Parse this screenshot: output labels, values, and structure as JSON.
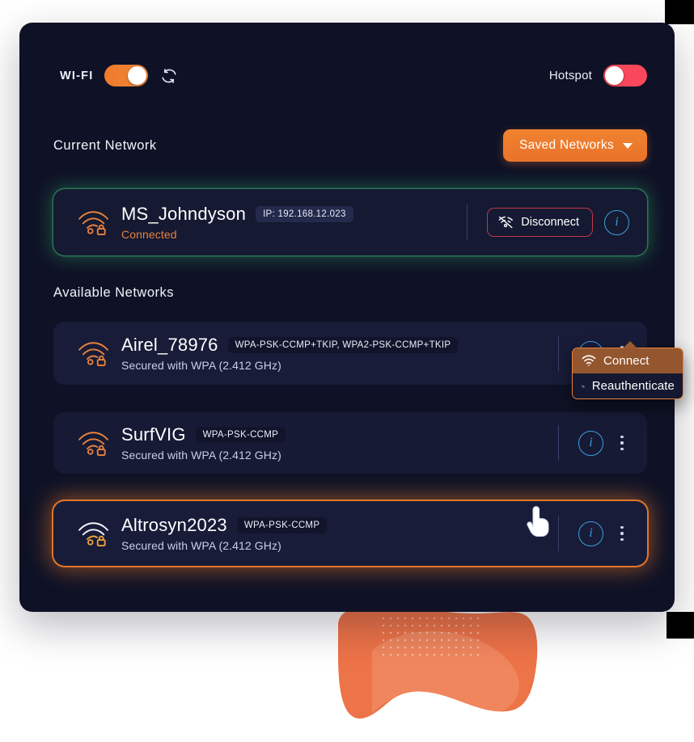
{
  "header": {
    "wifi_label": "WI-FI",
    "wifi_toggle_state": "on",
    "refresh_icon": "refresh-icon",
    "hotspot_label": "Hotspot",
    "hotspot_toggle_state": "off"
  },
  "sections": {
    "current_title": "Current Network",
    "available_title": "Available Networks",
    "saved_networks_label": "Saved Networks"
  },
  "current_network": {
    "ssid": "MS_Johndyson",
    "ip_badge": "IP: 192.168.12.023",
    "status": "Connected",
    "disconnect_label": "Disconnect",
    "info_label": "i",
    "icon": "wifi-locked-icon"
  },
  "available_networks": [
    {
      "ssid": "Airel_78976",
      "security_badge": "WPA-PSK-CCMP+TKIP, WPA2-PSK-CCMP+TKIP",
      "detail": "Secured with WPA (2.412 GHz)",
      "info_label": "i",
      "icon": "wifi-locked-icon"
    },
    {
      "ssid": "SurfVIG",
      "security_badge": "WPA-PSK-CCMP",
      "detail": "Secured with WPA (2.412 GHz)",
      "info_label": "i",
      "icon": "wifi-locked-icon"
    },
    {
      "ssid": "Altrosyn2023",
      "security_badge": "WPA-PSK-CCMP",
      "detail": "Secured with WPA (2.412 GHz)",
      "info_label": "i",
      "icon": "wifi-locked-icon"
    }
  ],
  "context_menu": {
    "items": [
      {
        "label": "Connect",
        "icon": "wifi-icon",
        "highlighted": true
      },
      {
        "label": "Reauthenticate",
        "icon": "user-lock-icon",
        "highlighted": false
      }
    ]
  },
  "colors": {
    "accent_orange": "#e8823c",
    "panel_bg": "#0f1226",
    "card_bg": "#161a35",
    "toggle_on": "#f07b2a",
    "toggle_off": "#f9485b",
    "info_blue": "#3a9fdd",
    "danger_red": "#c2384a",
    "connected_glow": "#2ea064"
  }
}
